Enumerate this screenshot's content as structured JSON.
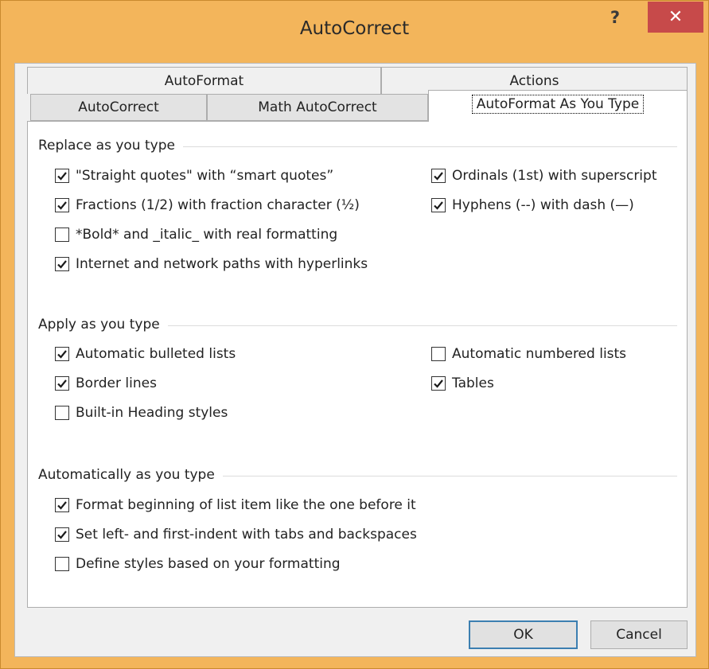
{
  "window": {
    "title": "AutoCorrect",
    "help_label": "?",
    "close_label": "✕"
  },
  "tabs": {
    "back_row": [
      {
        "label": "AutoFormat"
      },
      {
        "label": "Actions"
      }
    ],
    "front_row": [
      {
        "label": "AutoCorrect"
      },
      {
        "label": "Math AutoCorrect"
      },
      {
        "label": "AutoFormat As You Type",
        "active": true
      }
    ]
  },
  "groups": {
    "replace": {
      "label": "Replace as you type",
      "options": [
        {
          "label": "\"Straight quotes\" with “smart quotes”",
          "checked": true
        },
        {
          "label": "Fractions (1/2) with fraction character (½)",
          "checked": true
        },
        {
          "label": "*Bold* and _italic_ with real formatting",
          "checked": false
        },
        {
          "label": "Internet and network paths with hyperlinks",
          "checked": true
        },
        {
          "label": "Ordinals (1st) with superscript",
          "checked": true
        },
        {
          "label": "Hyphens (--) with dash (—)",
          "checked": true
        }
      ]
    },
    "apply": {
      "label": "Apply as you type",
      "options": [
        {
          "label": "Automatic bulleted lists",
          "checked": true
        },
        {
          "label": "Border lines",
          "checked": true
        },
        {
          "label": "Built-in Heading styles",
          "checked": false
        },
        {
          "label": "Automatic numbered lists",
          "checked": false
        },
        {
          "label": "Tables",
          "checked": true
        }
      ]
    },
    "auto": {
      "label": "Automatically as you type",
      "options": [
        {
          "label": "Format beginning of list item like the one before it",
          "checked": true
        },
        {
          "label": "Set left- and first-indent with tabs and backspaces",
          "checked": true
        },
        {
          "label": "Define styles based on your formatting",
          "checked": false
        }
      ]
    }
  },
  "buttons": {
    "ok": "OK",
    "cancel": "Cancel"
  },
  "colors": {
    "title_bar": "#f3b55b",
    "close_button": "#c74a4a",
    "default_button_border": "#3c7fb1"
  }
}
